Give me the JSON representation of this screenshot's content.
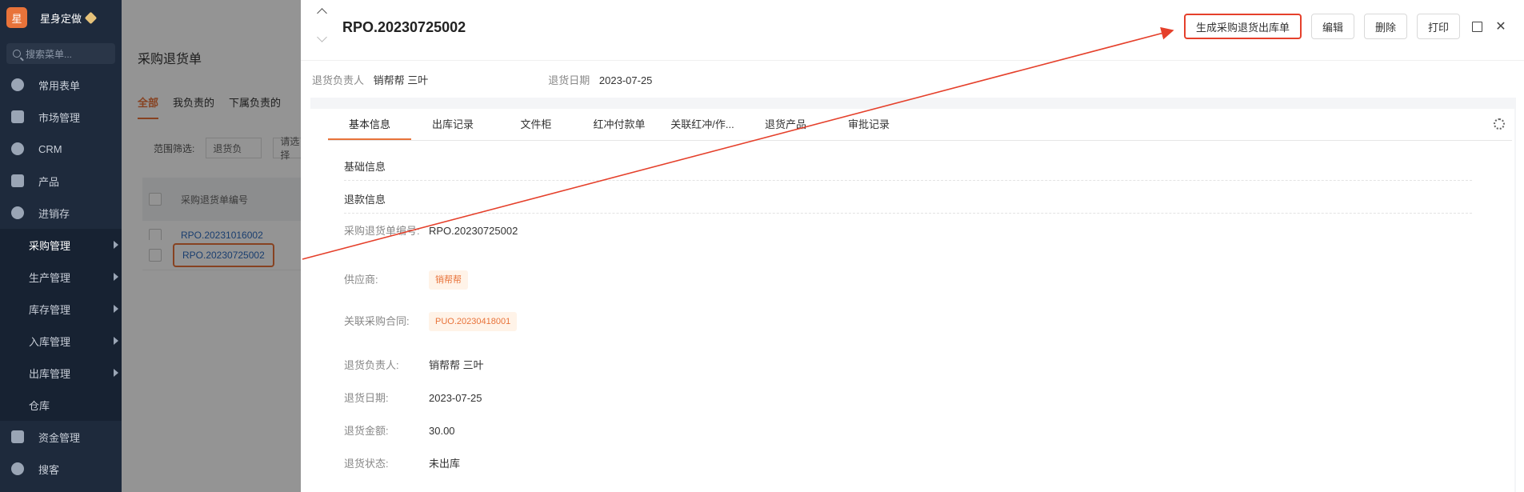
{
  "sidebar": {
    "brand_logo": "星",
    "brand_name": "星身定做",
    "search_placeholder": "搜索菜单...",
    "items": [
      {
        "label": "常用表单",
        "icon": "star-icon"
      },
      {
        "label": "市场管理",
        "icon": "briefcase-icon"
      },
      {
        "label": "CRM",
        "icon": "pie-icon"
      },
      {
        "label": "产品",
        "icon": "cube-icon"
      },
      {
        "label": "进销存",
        "icon": "cycle-icon"
      }
    ],
    "subitems": [
      "采购管理",
      "生产管理",
      "库存管理",
      "入库管理",
      "出库管理",
      "仓库"
    ],
    "bottom": [
      {
        "label": "资金管理",
        "icon": "money-icon"
      },
      {
        "label": "搜客",
        "icon": "search-icon"
      }
    ]
  },
  "list": {
    "page_title": "采购退货单",
    "tabs": [
      "全部",
      "我负责的",
      "下属负责的"
    ],
    "filter_label": "范围筛选:",
    "filter_value": "退货负",
    "filter_placeholder": "请选择",
    "column_header": "采购退货单编号",
    "rows": [
      "RPO.20231016002",
      "RPO.20230725002"
    ]
  },
  "drawer": {
    "title": "RPO.20230725002",
    "actions": {
      "generate": "生成采购退货出库单",
      "edit": "编辑",
      "delete": "删除",
      "print": "打印"
    },
    "meta": {
      "owner_label": "退货负责人",
      "owner_value": "销帮帮 三叶",
      "date_label": "退货日期",
      "date_value": "2023-07-25"
    },
    "tabs": [
      "基本信息",
      "出库记录",
      "文件柜",
      "红冲付款单",
      "关联红冲/作...",
      "退货产品",
      "审批记录"
    ],
    "sections": [
      "基础信息",
      "退款信息"
    ],
    "fields": {
      "no_label": "采购退货单编号:",
      "no_value": "RPO.20230725002",
      "supplier_label": "供应商:",
      "supplier_value": "销帮帮",
      "contract_label": "关联采购合同:",
      "contract_value": "PUO.20230418001",
      "owner_label": "退货负责人:",
      "owner_value": "销帮帮 三叶",
      "date_label": "退货日期:",
      "date_value": "2023-07-25",
      "amount_label": "退货金额:",
      "amount_value": "30.00",
      "status_label": "退货状态:",
      "status_value": "未出库"
    }
  },
  "colors": {
    "accent": "#e8733a",
    "highlight_red": "#e5402b",
    "sidebar_bg": "#1e2a3c",
    "link": "#2d6cc0"
  }
}
